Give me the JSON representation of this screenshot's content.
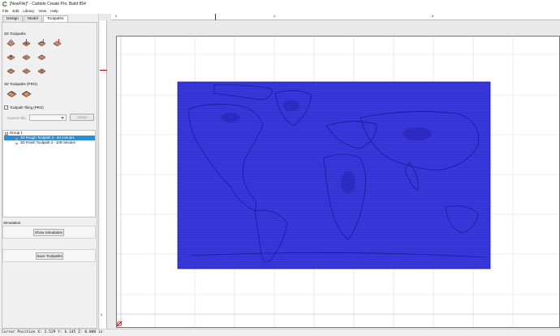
{
  "window": {
    "title": "[NewFile]* - Carbide Create Pro, Build 854"
  },
  "menu": [
    "File",
    "Edit",
    "Library",
    "View",
    "Help"
  ],
  "tabs": [
    {
      "label": "Design",
      "active": false
    },
    {
      "label": "Model",
      "active": false
    },
    {
      "label": "Toolpaths",
      "active": true
    }
  ],
  "panel": {
    "section_2d": "2D Toolpaths",
    "section_3d": "3D Toolpaths (PRO)",
    "tiling_label": "Toolpath Tiling (PRO)",
    "current_tile_label": "Current Tile",
    "setup_button": "Setup",
    "tree": {
      "group": "Group 1",
      "items": [
        {
          "label": "3D Rough Toolpath 2 - 64 minutes",
          "selected": true
        },
        {
          "label": "3D Finish Toolpath 3 - 109 minutes",
          "selected": false
        }
      ]
    },
    "simulation_label": "Simulation",
    "show_simulation_button": "Show Simulation",
    "save_toolpaths_button": "Save Toolpaths"
  },
  "rulers": {
    "top": [
      "0",
      "4",
      "8"
    ],
    "left": [
      "0"
    ]
  },
  "status": {
    "cursor": "Cursor Position X: 2.529 Y: 6.145 Z: 0.000 in"
  },
  "colors": {
    "toolpath": "#3535d8",
    "selection": "#2e8cd0",
    "marker_red": "#d00000"
  }
}
